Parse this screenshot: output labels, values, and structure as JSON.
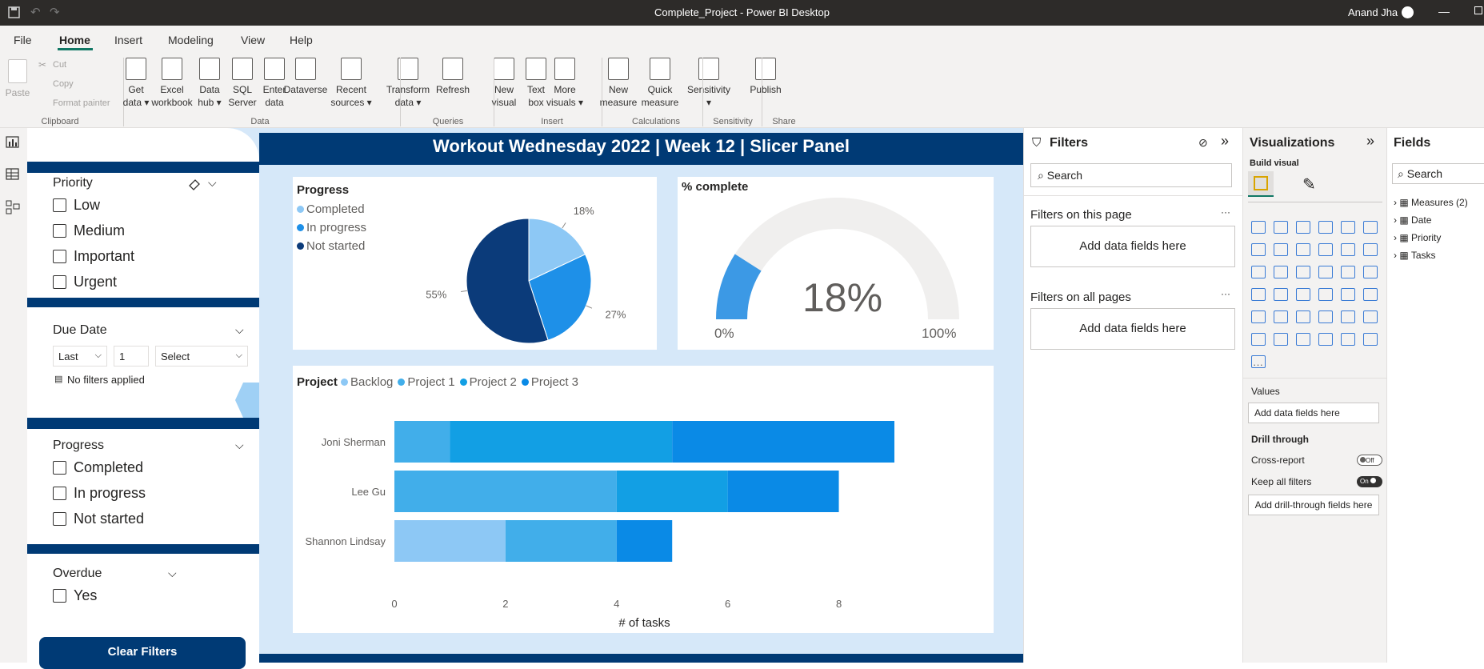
{
  "titlebar": {
    "title": "Complete_Project - Power BI Desktop",
    "user": "Anand Jha"
  },
  "menu": [
    "File",
    "Home",
    "Insert",
    "Modeling",
    "View",
    "Help"
  ],
  "ribbon": {
    "paste": "Paste",
    "cut": "Cut",
    "copy": "Copy",
    "format_painter": "Format painter",
    "clipboard": "Clipboard",
    "buttons": [
      {
        "l1": "Get",
        "l2": "data ▾",
        "x": 170
      },
      {
        "l1": "Excel",
        "l2": "workbook",
        "x": 215
      },
      {
        "l1": "Data",
        "l2": "hub ▾",
        "x": 262
      },
      {
        "l1": "SQL",
        "l2": "Server",
        "x": 303
      },
      {
        "l1": "Enter",
        "l2": "data",
        "x": 343
      },
      {
        "l1": "Dataverse",
        "l2": "",
        "x": 382
      },
      {
        "l1": "Recent",
        "l2": "sources ▾",
        "x": 439
      },
      {
        "l1": "Transform",
        "l2": "data ▾",
        "x": 510
      },
      {
        "l1": "Refresh",
        "l2": "",
        "x": 566
      },
      {
        "l1": "New",
        "l2": "visual",
        "x": 630
      },
      {
        "l1": "Text",
        "l2": "box",
        "x": 670
      },
      {
        "l1": "More",
        "l2": "visuals ▾",
        "x": 706
      },
      {
        "l1": "New",
        "l2": "measure",
        "x": 773
      },
      {
        "l1": "Quick",
        "l2": "measure",
        "x": 825
      },
      {
        "l1": "Sensitivity",
        "l2": "▾",
        "x": 886
      },
      {
        "l1": "Publish",
        "l2": "",
        "x": 957
      }
    ],
    "groups": {
      "data": "Data",
      "queries": "Queries",
      "insert": "Insert",
      "calculations": "Calculations",
      "sensitivity": "Sensitivity",
      "share": "Share"
    }
  },
  "banner": {
    "title": "Workout Wednesday 2022 | Week 12 | Slicer Panel"
  },
  "slicer": {
    "priority": {
      "header": "Priority",
      "items": [
        "Low",
        "Medium",
        "Important",
        "Urgent"
      ]
    },
    "due_date": {
      "header": "Due Date",
      "mode": "Last",
      "count": "1",
      "unit": "Select",
      "status": "No filters applied"
    },
    "progress": {
      "header": "Progress",
      "items": [
        "Completed",
        "In progress",
        "Not started"
      ]
    },
    "overdue": {
      "header": "Overdue",
      "items": [
        "Yes"
      ]
    },
    "clear": "Clear Filters"
  },
  "pie": {
    "title": "Progress",
    "legend": [
      "Completed",
      "In progress",
      "Not started"
    ],
    "labels": [
      "18%",
      "27%",
      "55%"
    ]
  },
  "gauge": {
    "title": "% complete",
    "value": "18%",
    "min": "0%",
    "max": "100%",
    "fraction": 0.18
  },
  "bar": {
    "legend_title": "Project",
    "xlabel": "# of tasks",
    "ticks": [
      "0",
      "2",
      "4",
      "6",
      "8"
    ]
  },
  "chart_data": [
    {
      "type": "pie",
      "title": "Progress",
      "categories": [
        "Completed",
        "In progress",
        "Not started"
      ],
      "values": [
        18,
        27,
        55
      ],
      "colors": [
        "#8dc8f5",
        "#1e90e8",
        "#0b3b7a"
      ]
    },
    {
      "type": "gauge",
      "title": "% complete",
      "value": 18,
      "min": 0,
      "max": 100
    },
    {
      "type": "bar",
      "orientation": "horizontal",
      "stacked": true,
      "categories": [
        "Joni Sherman",
        "Lee Gu",
        "Shannon Lindsay"
      ],
      "series": [
        {
          "name": "Backlog",
          "values": [
            0,
            0,
            2
          ],
          "color": "#8dc8f5"
        },
        {
          "name": "Project 1",
          "values": [
            1,
            4,
            2
          ],
          "color": "#41aeea"
        },
        {
          "name": "Project 2",
          "values": [
            4,
            2,
            0
          ],
          "color": "#129fe4"
        },
        {
          "name": "Project 3",
          "values": [
            4,
            2,
            1
          ],
          "color": "#0a8ae6"
        }
      ],
      "xlabel": "# of tasks",
      "xlim": [
        0,
        9
      ]
    }
  ],
  "filters": {
    "title": "Filters",
    "search": "Search",
    "page": "Filters on this page",
    "all": "Filters on all pages",
    "add": "Add data fields here",
    "more": "···"
  },
  "viz": {
    "title": "Visualizations",
    "build": "Build visual",
    "values": "Values",
    "add_values": "Add data fields here",
    "drill": "Drill through",
    "cross": "Cross-report",
    "cross_state": "Off",
    "keep": "Keep all filters",
    "keep_state": "On",
    "add_drill": "Add drill-through fields here"
  },
  "fields": {
    "title": "Fields",
    "search": "Search",
    "items": [
      "Measures (2)",
      "Date",
      "Priority",
      "Tasks"
    ]
  }
}
